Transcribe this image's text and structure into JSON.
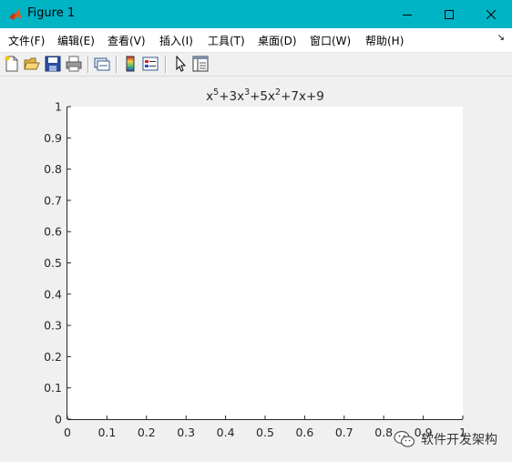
{
  "window": {
    "title": "Figure 1"
  },
  "menu": {
    "items": [
      "文件(F)",
      "编辑(E)",
      "查看(V)",
      "插入(I)",
      "工具(T)",
      "桌面(D)",
      "窗口(W)",
      "帮助(H)"
    ]
  },
  "toolbar": {
    "icons": [
      "new-figure-icon",
      "open-file-icon",
      "save-icon",
      "print-icon",
      "link-plot-icon",
      "colorbar-icon",
      "legend-icon",
      "pointer-icon",
      "property-editor-icon"
    ]
  },
  "chart_data": {
    "type": "line",
    "title": "x^5+3x^3+5x^2+7x+9",
    "title_parts": [
      "x",
      "5",
      "+3x",
      "3",
      "+5x",
      "2",
      "+7x+9"
    ],
    "xlabel": "",
    "ylabel": "",
    "xlim": [
      0,
      1
    ],
    "ylim": [
      0,
      1
    ],
    "xticks": [
      "0",
      "0.1",
      "0.2",
      "0.3",
      "0.4",
      "0.5",
      "0.6",
      "0.7",
      "0.8",
      "0.9",
      "1"
    ],
    "yticks": [
      "0",
      "0.1",
      "0.2",
      "0.3",
      "0.4",
      "0.5",
      "0.6",
      "0.7",
      "0.8",
      "0.9",
      "1"
    ],
    "series": [],
    "grid": false
  },
  "watermark": {
    "text": "软件开发架构"
  }
}
